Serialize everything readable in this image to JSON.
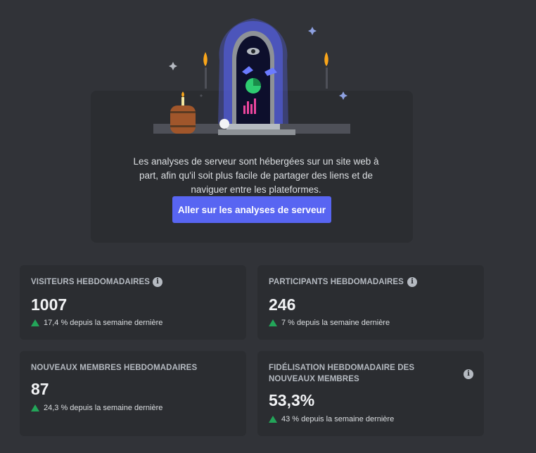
{
  "promo": {
    "description": "Les analyses de serveur sont hébergées sur un site web à part, afin qu'il soit plus facile de partager des liens et de naviguer entre les plateformes.",
    "button_label": "Aller sur les analyses de serveur"
  },
  "stats": [
    {
      "title": "VISITEURS HEBDOMADAIRES",
      "value": "1007",
      "delta": "17,4 % depuis la semaine dernière",
      "has_info": true
    },
    {
      "title": "PARTICIPANTS HEBDOMADAIRES",
      "value": "246",
      "delta": "7 % depuis la semaine dernière",
      "has_info": true
    },
    {
      "title": "NOUVEAUX MEMBRES HEBDOMADAIRES",
      "value": "87",
      "delta": "24,3 % depuis la semaine dernière",
      "has_info": false
    },
    {
      "title": "FIDÉLISATION HEBDOMADAIRE DES NOUVEAUX MEMBRES",
      "value": "53,3%",
      "delta": "43 % depuis la semaine dernière",
      "has_info": true
    }
  ],
  "colors": {
    "background": "#313338",
    "card": "#2b2d31",
    "accent": "#5865f2",
    "positive": "#23a559"
  }
}
